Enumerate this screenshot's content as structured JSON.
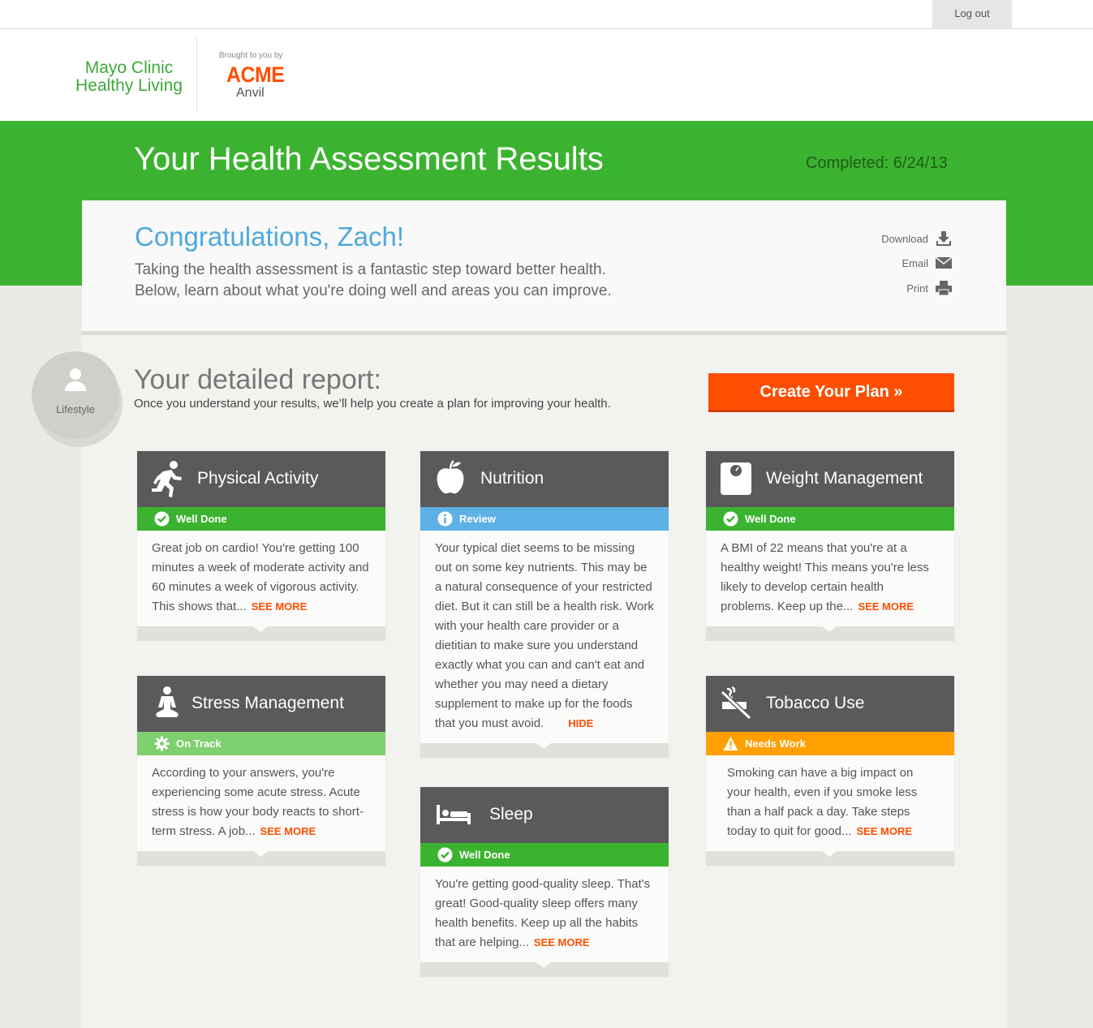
{
  "topbar": {
    "logout": "Log out"
  },
  "header": {
    "brand_line1": "Mayo Clinic",
    "brand_line2": "Healthy Living",
    "sponsor_small": "Brought to you by",
    "sponsor_name": "ACME",
    "sponsor_sub": "Anvil"
  },
  "banner": {
    "title": "Your Health Assessment Results",
    "completed": "Completed: 6/24/13"
  },
  "intro": {
    "heading": "Congratulations, Zach!",
    "line1": "Taking the health assessment is a fantastic step toward better health.",
    "line2": "Below, learn about what you're doing well and areas you can improve.",
    "actions": {
      "download": "Download",
      "email": "Email",
      "print": "Print"
    }
  },
  "report": {
    "badge": "Lifestyle",
    "title": "Your detailed report:",
    "subtitle": "Once you understand your results, we’ll help you create a plan for improving your health.",
    "cta": "Create Your Plan »"
  },
  "cards": {
    "physical": {
      "title": "Physical Activity",
      "status": "Well Done",
      "text": "Great job on cardio! You're getting 100 minutes a week of moderate activity and 60 minutes a week of vigorous activity. This shows that...",
      "link": "SEE MORE"
    },
    "nutrition": {
      "title": "Nutrition",
      "status": "Review",
      "text": "Your typical diet seems to be missing out on some key nutrients. This may be a natural consequence of your restricted diet. But it can still be a health risk. Work with your health care provider or a dietitian to make sure you understand exactly what you can and can't eat and whether you may need a dietary supplement to make up for the foods that you must avoid.",
      "link": "HIDE"
    },
    "weight": {
      "title": "Weight Management",
      "status": "Well Done",
      "text": "A BMI of 22 means that you're at a healthy weight! This means you're less likely to develop certain health problems. Keep up the...",
      "link": "SEE MORE"
    },
    "stress": {
      "title": "Stress Management",
      "status": "On Track",
      "text": "According to your answers, you're experiencing some acute stress. Acute stress is how your body reacts to short-term stress. A job...",
      "link": "SEE MORE"
    },
    "sleep": {
      "title": "Sleep",
      "status": "Well Done",
      "text": "You're getting good-quality sleep. That's great! Good-quality sleep offers many health benefits. Keep up all the habits that are helping...",
      "link": "SEE MORE"
    },
    "tobacco": {
      "title": "Tobacco Use",
      "status": "Needs Work",
      "text": "Smoking can have a big impact on your health, even if you smoke less than a half pack a day. Take steps today to quit for good...",
      "link": "SEE MORE"
    }
  },
  "colors": {
    "brand_green": "#3cb330",
    "accent_orange": "#ff4e00",
    "review_blue": "#5eb1e6",
    "on_track_green": "#7fd06e",
    "needs_work_orange": "#ff9f00",
    "heading_blue": "#4ea9dd"
  }
}
